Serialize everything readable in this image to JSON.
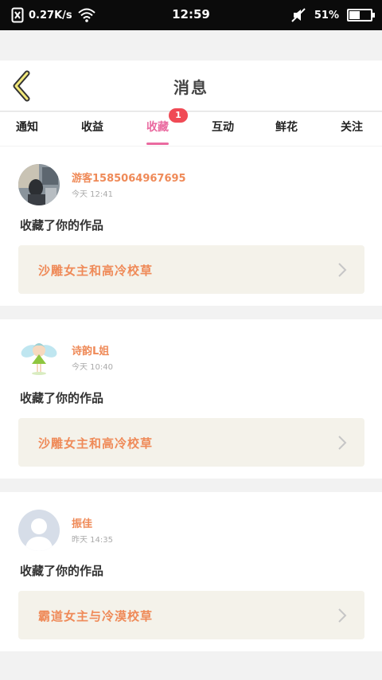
{
  "status_bar": {
    "speed": "0.27K/s",
    "time": "12:59",
    "battery": "51%",
    "battery_level": 0.51
  },
  "header": {
    "title": "消息",
    "back_icon": "chevron-left-icon",
    "accent": "#ea6aa0"
  },
  "tabs": [
    {
      "label": "通知"
    },
    {
      "label": "收益"
    },
    {
      "label": "收藏",
      "active": true,
      "badge": "1"
    },
    {
      "label": "互动"
    },
    {
      "label": "鲜花"
    },
    {
      "label": "关注"
    }
  ],
  "messages": [
    {
      "user": "游客1585064967695",
      "time": "今天 12:41",
      "action": "收藏了你的作品",
      "work": "沙雕女主和高冷校草"
    },
    {
      "user": "诗韵L姐",
      "time": "今天 10:40",
      "action": "收藏了你的作品",
      "work": "沙雕女主和高冷校草"
    },
    {
      "user": "振佳",
      "time": "昨天 14:35",
      "action": "收藏了你的作品",
      "work": "霸道女主与冷漠校草"
    }
  ]
}
